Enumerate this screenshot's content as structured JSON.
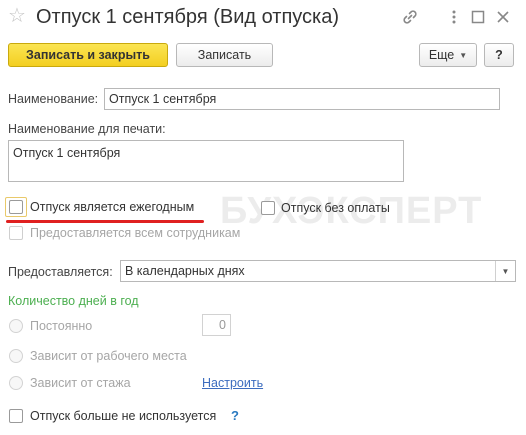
{
  "window": {
    "title": "Отпуск 1 сентября (Вид отпуска)"
  },
  "toolbar": {
    "save_close_label": "Записать и закрыть",
    "save_label": "Записать",
    "more_label": "Еще",
    "help_label": "?"
  },
  "form": {
    "name_label": "Наименование:",
    "name_value": "Отпуск 1 сентября",
    "print_name_label": "Наименование для печати:",
    "print_name_value": "Отпуск 1 сентября",
    "annual_label": "Отпуск является ежегодным",
    "annual_checked": false,
    "unpaid_label": "Отпуск без оплаты",
    "unpaid_checked": false,
    "all_employees_label": "Предоставляется всем сотрудникам",
    "provided_label": "Предоставляется:",
    "provided_value": "В календарных днях",
    "days_section_title": "Количество дней в год",
    "radio_permanent_label": "Постоянно",
    "permanent_days_value": "0",
    "radio_workplace_label": "Зависит от рабочего места",
    "radio_seniority_label": "Зависит от стажа",
    "configure_link": "Настроить",
    "not_used_label": "Отпуск больше не используется",
    "not_used_help": "?"
  },
  "watermark": {
    "text": "БУХЭКСПЕРТ"
  },
  "colors": {
    "primary_button": "#f3cf21",
    "section_title": "#4caf50",
    "link": "#3d6dbf",
    "highlight_underline": "#e02020"
  }
}
